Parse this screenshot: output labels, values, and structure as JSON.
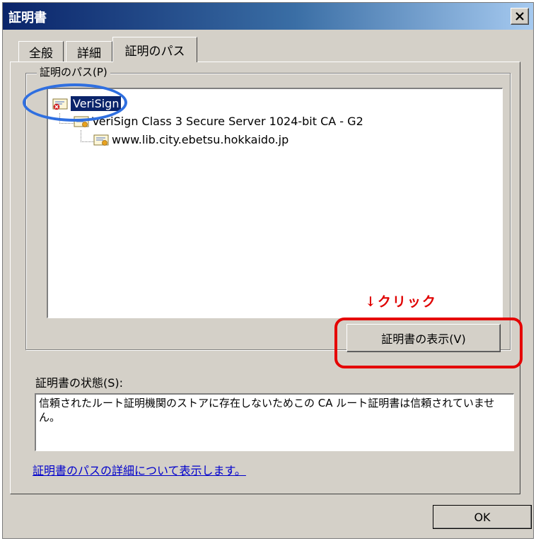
{
  "window": {
    "title": "証明書",
    "close_glyph": "✕"
  },
  "tabs": [
    {
      "label": "全般",
      "active": false
    },
    {
      "label": "詳細",
      "active": false
    },
    {
      "label": "証明のパス",
      "active": true
    }
  ],
  "path_group": {
    "label": "証明のパス(P)",
    "nodes": [
      {
        "label": "VeriSign",
        "level": 0,
        "selected": true,
        "icon": "certificate-error-icon"
      },
      {
        "label": "VeriSign Class 3 Secure Server 1024-bit CA - G2",
        "level": 1,
        "selected": false,
        "icon": "certificate-icon"
      },
      {
        "label": "www.lib.city.ebetsu.hokkaido.jp",
        "level": 2,
        "selected": false,
        "icon": "certificate-icon"
      }
    ],
    "view_button_label": "証明書の表示(V)"
  },
  "status": {
    "label": "証明書の状態(S):",
    "text": "信頼されたルート証明機関のストアに存在しないためこの CA ルート証明書は信頼されていません。"
  },
  "details_link": "証明書のパスの詳細について表示します。",
  "ok_label": "OK",
  "annotations": {
    "click_hint": "↓クリック",
    "ellipse_color": "#2f6fe0",
    "rect_color": "#e50000"
  },
  "colors": {
    "dialog_face": "#d4d0c8",
    "title_start": "#0a246a",
    "selection": "#0a246a",
    "link": "#0000cc"
  }
}
